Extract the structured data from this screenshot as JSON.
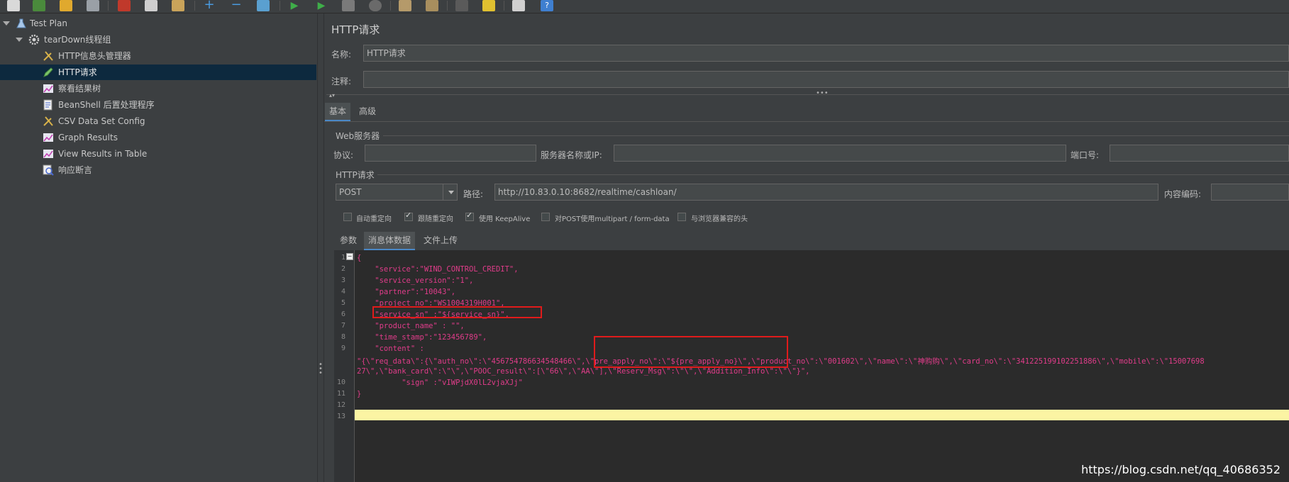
{
  "tree": [
    {
      "label": "Test Plan",
      "icon": "flask-icon"
    },
    {
      "label": "tearDown线程组",
      "icon": "gear-icon"
    },
    {
      "label": "HTTP信息头管理器",
      "icon": "wrench-icon"
    },
    {
      "label": "HTTP请求",
      "icon": "pen-icon"
    },
    {
      "label": "察看结果树",
      "icon": "graph-icon"
    },
    {
      "label": "BeanShell 后置处理程序",
      "icon": "script-icon"
    },
    {
      "label": "CSV Data Set Config",
      "icon": "wrench-icon"
    },
    {
      "label": "Graph Results",
      "icon": "graph-icon"
    },
    {
      "label": "View Results in Table",
      "icon": "graph-icon"
    },
    {
      "label": "响应断言",
      "icon": "magnifier-icon"
    }
  ],
  "panel": {
    "title": "HTTP请求",
    "name_label": "名称:",
    "name_value": "HTTP请求",
    "comment_label": "注释:",
    "comment_value": "",
    "tabs": [
      "基本",
      "高级"
    ],
    "web_server_title": "Web服务器",
    "protocol_label": "协议:",
    "protocol_value": "",
    "server_label": "服务器名称或IP:",
    "server_value": "",
    "port_label": "端口号:",
    "port_value": "",
    "http_request_title": "HTTP请求",
    "method": "POST",
    "path_label": "路径:",
    "path_value": "http://10.83.0.10:8682/realtime/cashloan/",
    "encoding_label": "内容编码:",
    "encoding_value": "",
    "checkboxes": [
      {
        "label": "自动重定向",
        "checked": false
      },
      {
        "label": "跟随重定向",
        "checked": true
      },
      {
        "label": "使用 KeepAlive",
        "checked": true
      },
      {
        "label": "对POST使用multipart / form-data",
        "checked": false
      },
      {
        "label": "与浏览器兼容的头",
        "checked": false
      }
    ],
    "body_tabs": [
      "参数",
      "消息体数据",
      "文件上传"
    ]
  },
  "editor": {
    "line_numbers": [
      "1",
      "2",
      "3",
      "4",
      "5",
      "6",
      "7",
      "8",
      "9",
      "",
      "",
      "10",
      "11",
      "12",
      "13"
    ],
    "lines": [
      "{",
      "    \"service\":\"WIND_CONTROL_CREDIT\",",
      "    \"service_version\":\"1\",",
      "    \"partner\":\"10043\",",
      "    \"project_no\":\"WS1004319H001\",",
      "    \"service_sn\" :\"${service_sn}\",",
      "    \"product_name\" : \"\",",
      "    \"time_stamp\":\"123456789\",",
      "    \"content\" :",
      "\"{\\\"req_data\\\":{\\\"auth_no\\\":\\\"456754786634548466\\\",\\\"pre_apply_no\\\":\\\"${pre_apply_no}\\\",\\\"product_no\\\":\\\"001602\\\",\\\"name\\\":\\\"神购购\\\",\\\"card_no\\\":\\\"341225199102251886\\\",\\\"mobile\\\":\\\"15007698",
      "27\\\",\\\"bank_card\\\":\\\"\\\",\\\"POOC_result\\\":[\\\"66\\\",\\\"AA\\\"],\\\"Reserv_Msg\\\":\\\"\\\",\\\"Addition_Info\\\":\\\"\\\"}\",",
      "          \"sign\" :\"vIWPjdX0lL2vjaXJj\"",
      "}",
      "",
      ""
    ]
  },
  "watermark": "https://blog.csdn.net/qq_40686352"
}
